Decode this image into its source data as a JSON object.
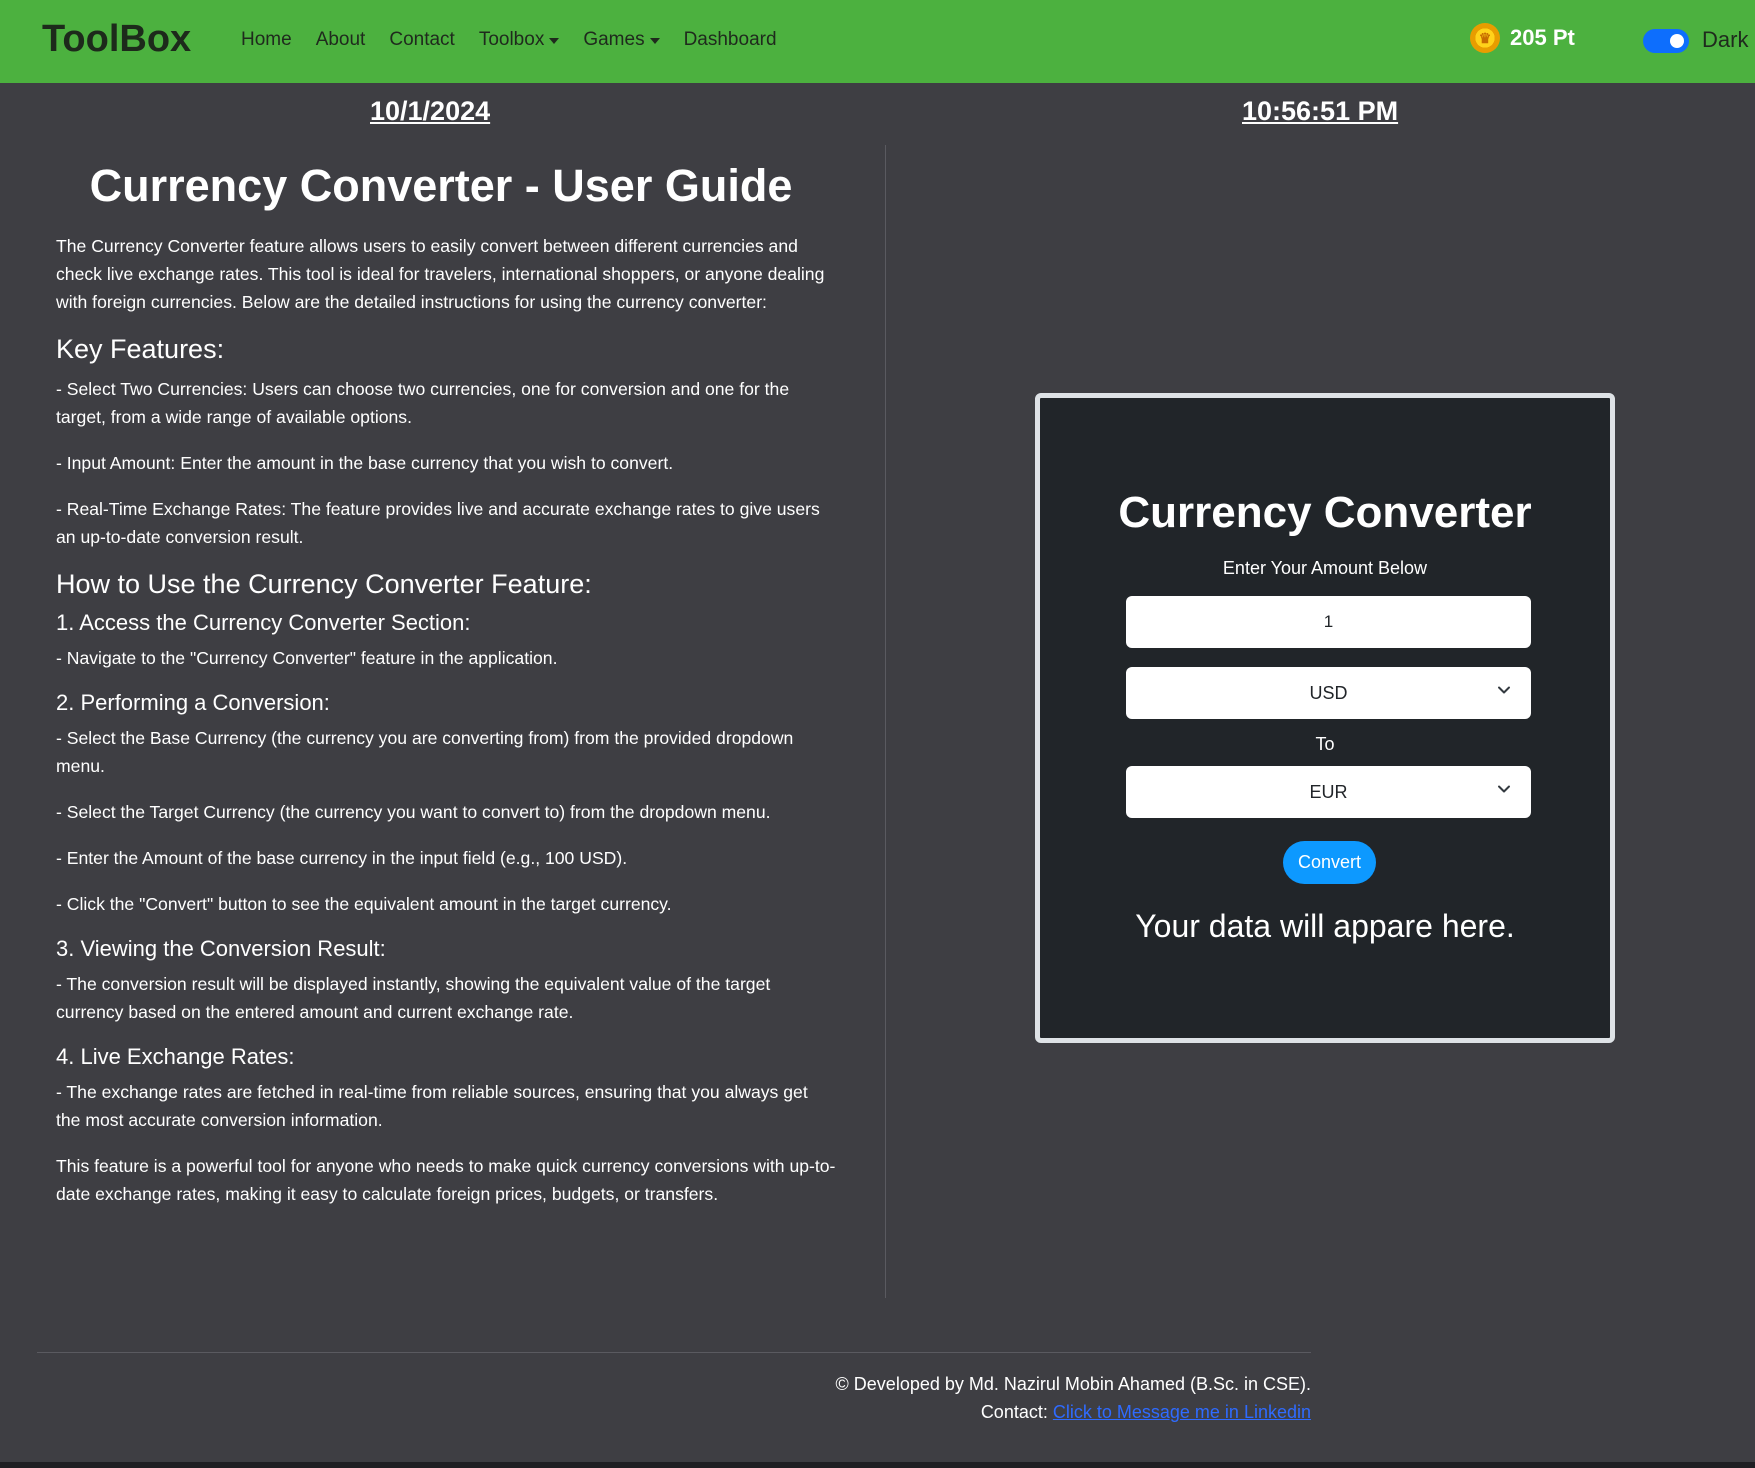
{
  "navbar": {
    "brand": "ToolBox",
    "links": [
      "Home",
      "About",
      "Contact",
      "Toolbox",
      "Games",
      "Dashboard"
    ],
    "points": "205 Pt",
    "theme_label": "Dark",
    "accent_color": "#4cb13f"
  },
  "datetime": {
    "date": "10/1/2024",
    "time": "10:56:51 PM"
  },
  "guide": {
    "title": "Currency Converter - User Guide",
    "intro": "The Currency Converter feature allows users to easily convert between different currencies and check live exchange rates. This tool is ideal for travelers, international shoppers, or anyone dealing with foreign currencies. Below are the detailed instructions for using the currency converter:",
    "key_features_heading": "Key Features:",
    "key_features": [
      "- Select Two Currencies: Users can choose two currencies, one for conversion and one for the target, from a wide range of available options.",
      "- Input Amount: Enter the amount in the base currency that you wish to convert.",
      "- Real-Time Exchange Rates: The feature provides live and accurate exchange rates to give users an up-to-date conversion result."
    ],
    "how_to_heading": "How to Use the Currency Converter Feature:",
    "step1_heading": "1. Access the Currency Converter Section:",
    "step1_items": [
      "- Navigate to the \"Currency Converter\" feature in the application."
    ],
    "step2_heading": "2. Performing a Conversion:",
    "step2_items": [
      "- Select the Base Currency (the currency you are converting from) from the provided dropdown menu.",
      "- Select the Target Currency (the currency you want to convert to) from the dropdown menu.",
      "- Enter the Amount of the base currency in the input field (e.g., 100 USD).",
      "- Click the \"Convert\" button to see the equivalent amount in the target currency."
    ],
    "step3_heading": "3. Viewing the Conversion Result:",
    "step3_items": [
      "- The conversion result will be displayed instantly, showing the equivalent value of the target currency based on the entered amount and current exchange rate."
    ],
    "step4_heading": "4. Live Exchange Rates:",
    "step4_items": [
      "- The exchange rates are fetched in real-time from reliable sources, ensuring that you always get the most accurate conversion information."
    ],
    "closing": "This feature is a powerful tool for anyone who needs to make quick currency conversions with up-to-date exchange rates, making it easy to calculate foreign prices, budgets, or transfers."
  },
  "converter": {
    "title": "Currency Converter",
    "subtitle": "Enter Your Amount Below",
    "amount_value": "1",
    "from_currency": "USD",
    "to_label": "To",
    "to_currency": "EUR",
    "convert_label": "Convert",
    "result_text": "Your data will appare here."
  },
  "footer": {
    "credit": "© Developed by Md. Nazirul Mobin Ahamed (B.Sc. in CSE).",
    "contact_label": "Contact:",
    "contact_link": "Click to Message me in Linkedin"
  }
}
